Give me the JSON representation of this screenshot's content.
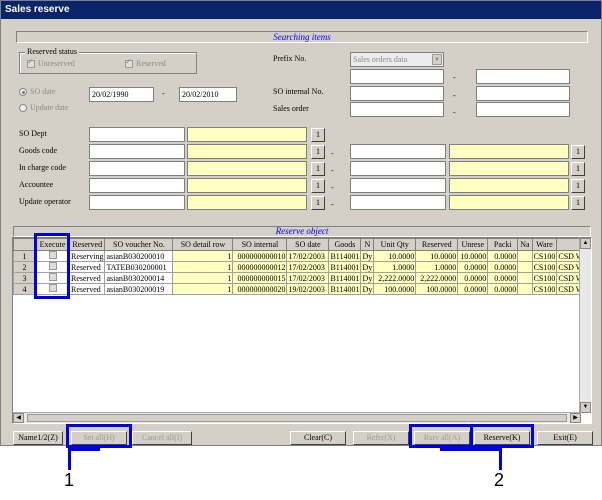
{
  "window": {
    "title": "Sales reserve"
  },
  "search": {
    "header": "Searching items",
    "reserved_status": {
      "label": "Reserved status",
      "unreserved": "Unreserved",
      "reserved": "Reserved"
    },
    "so_date_radio": "SO date",
    "update_date_radio": "Update date",
    "date_from": "20/02/1990",
    "date_to": "20/02/2010",
    "date_sep": "-",
    "prefix_no_label": "Prefix No.",
    "prefix_no_value": "Sales orders data",
    "so_internal_no_label": "SO internal No.",
    "sales_order_label": "Sales order",
    "so_dept_label": "SO Dept",
    "goods_code_label": "Goods code",
    "in_charge_code_label": "In charge code",
    "accountee_label": "Accountee",
    "update_operator_label": "Update operator",
    "lookup_button": "1",
    "range_sep": "-"
  },
  "reserve": {
    "header": "Reserve object",
    "columns": [
      "",
      "Execute",
      "Reserved",
      "SO voucher No.",
      "SO detail row",
      "SO internal",
      "SO date",
      "Goods",
      "N",
      "Unit Qty",
      "Reserved",
      "Unrese",
      "Packi",
      "Na",
      "Ware",
      ""
    ],
    "rows": [
      [
        "1",
        "",
        "Reserving",
        "asianB030200010",
        "1",
        "000000000010",
        "17/02/2003",
        "B114001",
        "Dy",
        "10.0000",
        "10.0000",
        "10.0000",
        "0.0000",
        "",
        "CS100",
        "CSD W"
      ],
      [
        "2",
        "",
        "Reserved",
        "TATEB030200001",
        "1",
        "000000000012",
        "17/02/2003",
        "B114001",
        "Dy",
        "1.0000",
        "1.0000",
        "0.0000",
        "0.0000",
        "",
        "CS100",
        "CSD W"
      ],
      [
        "3",
        "",
        "Reserved",
        "asianB030200014",
        "1",
        "000000000015",
        "17/02/2003",
        "B114001",
        "Dy",
        "2,222.0000",
        "2,222.0000",
        "0.0000",
        "0.0000",
        "",
        "CS100",
        "CSD W"
      ],
      [
        "4",
        "",
        "Reserved",
        "asianB030200019",
        "1",
        "000000000020",
        "19/02/2003",
        "B114001",
        "Dy",
        "100.0000",
        "100.0000",
        "0.0000",
        "0.0000",
        "",
        "CS100",
        "CSD W"
      ]
    ]
  },
  "buttons": {
    "name": "Name1/2(Z)",
    "set_all": "Set all(H)",
    "cancel_all": "Cancel all(I)",
    "clear": "Clear(C)",
    "refer": "Refer(X)",
    "rsrv_all": "Rsrv all(A)",
    "reserve": "Reserve(K)",
    "exit": "Exit(E)"
  },
  "callouts": {
    "one": "1",
    "two": "2"
  },
  "colors": {
    "callout": "#0000e0",
    "title_bar": "#0a246a",
    "yellow_field": "#ffffc0"
  }
}
